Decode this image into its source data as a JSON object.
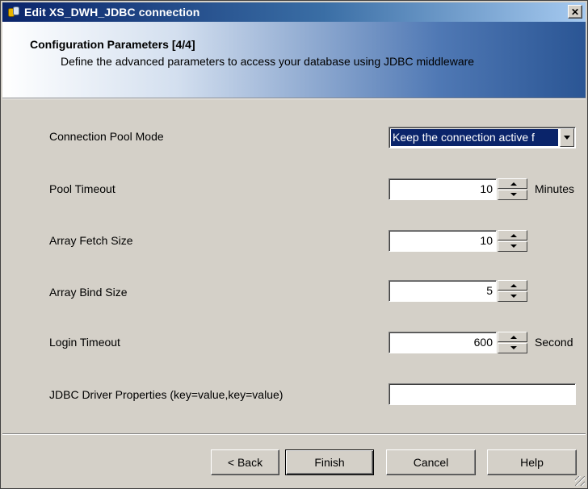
{
  "window": {
    "title": "Edit XS_DWH_JDBC connection"
  },
  "header": {
    "title": "Configuration Parameters [4/4]",
    "description": "Define the advanced parameters to access your database using JDBC middleware"
  },
  "form": {
    "connection_pool_mode": {
      "label": "Connection Pool Mode",
      "value": "Keep the connection active f"
    },
    "pool_timeout": {
      "label": "Pool Timeout",
      "value": "10",
      "unit": "Minutes"
    },
    "array_fetch_size": {
      "label": "Array Fetch Size",
      "value": "10"
    },
    "array_bind_size": {
      "label": "Array Bind Size",
      "value": "5"
    },
    "login_timeout": {
      "label": "Login Timeout",
      "value": "600",
      "unit": "Second"
    },
    "jdbc_driver_properties": {
      "label": "JDBC Driver Properties (key=value,key=value)",
      "value": ""
    }
  },
  "buttons": {
    "back": "< Back",
    "finish": "Finish",
    "cancel": "Cancel",
    "help": "Help"
  },
  "icons": {
    "close": "✕"
  },
  "colors": {
    "title_bar": "#0a246a",
    "selection": "#0a246a",
    "dialog_bg": "#d4d0c8"
  }
}
